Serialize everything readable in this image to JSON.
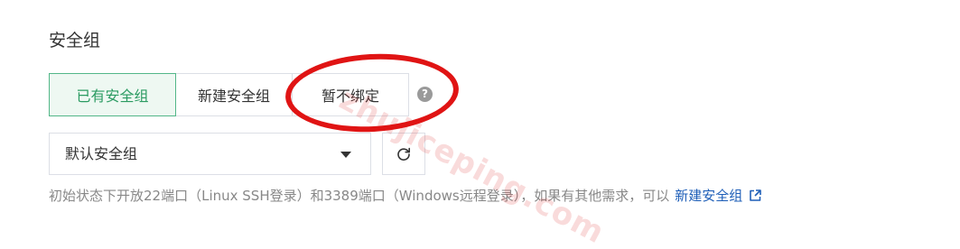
{
  "section": {
    "title": "安全组"
  },
  "bind_mode": {
    "options": [
      "已有安全组",
      "新建安全组",
      "暂不绑定"
    ],
    "selected": "已有安全组"
  },
  "help_icon": "question-circle-icon",
  "select": {
    "value": "默认安全组",
    "icon": "caret-down-icon"
  },
  "refresh_icon": "refresh-icon",
  "hint": {
    "text": "初始状态下开放22端口（Linux SSH登录）和3389端口（Windows远程登录），如果有其他需求，可以",
    "link": "新建安全组",
    "link_icon": "external-link-icon"
  },
  "watermark": "zhujiceping.com",
  "colors": {
    "accent": "#2b9b62",
    "active_bg": "#eef8f2",
    "link": "#1f5fb8",
    "annotation": "#e01414"
  }
}
